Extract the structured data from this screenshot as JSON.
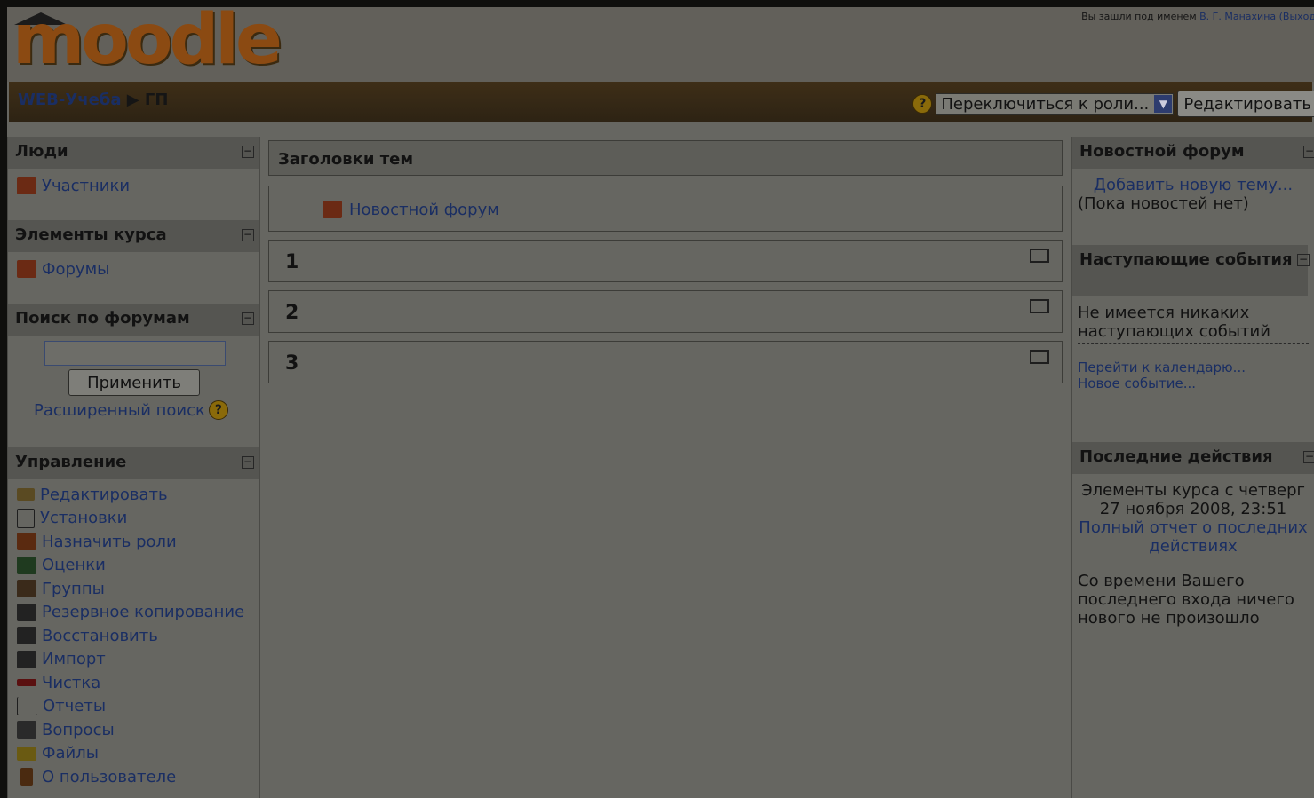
{
  "header": {
    "logo_text": "moodle",
    "login_prefix": "Вы зашли под именем ",
    "login_user": "В. Г. Манахина",
    "logout": "(Выход"
  },
  "navbar": {
    "breadcrumb_home": "WEB-Учеба",
    "breadcrumb_sep": "▶",
    "breadcrumb_current": "ГП",
    "help_glyph": "?",
    "role_select_value": "Переключиться к роли...",
    "edit_button": "Редактировать"
  },
  "left": {
    "people": {
      "title": "Люди",
      "items": [
        "Участники"
      ]
    },
    "activities": {
      "title": "Элементы курса",
      "items": [
        "Форумы"
      ]
    },
    "search": {
      "title": "Поиск по форумам",
      "button": "Применить",
      "advanced": "Расширенный поиск"
    },
    "admin": {
      "title": "Управление",
      "items": [
        {
          "label": "Редактировать",
          "icon": "pencil-icon"
        },
        {
          "label": "Установки",
          "icon": "settings-icon"
        },
        {
          "label": "Назначить роли",
          "icon": "roles-icon"
        },
        {
          "label": "Оценки",
          "icon": "grades-icon"
        },
        {
          "label": "Группы",
          "icon": "groups-icon"
        },
        {
          "label": "Резервное копирование",
          "icon": "backup-icon"
        },
        {
          "label": "Восстановить",
          "icon": "restore-icon"
        },
        {
          "label": "Импорт",
          "icon": "import-icon"
        },
        {
          "label": "Чистка",
          "icon": "reset-icon"
        },
        {
          "label": "Отчеты",
          "icon": "reports-icon"
        },
        {
          "label": "Вопросы",
          "icon": "questions-icon"
        },
        {
          "label": "Файлы",
          "icon": "folder-icon"
        },
        {
          "label": "О пользователе",
          "icon": "profile-icon"
        }
      ]
    },
    "hide_glyph": "−"
  },
  "center": {
    "topics_header": "Заголовки тем",
    "news_forum": "Новостной форум",
    "sections": [
      "1",
      "2",
      "3"
    ]
  },
  "right": {
    "news": {
      "title": "Новостной форум",
      "add": "Добавить новую тему...",
      "none": "(Пока новостей нет)"
    },
    "events": {
      "title": "Наступающие события",
      "none": "Не имеется никаких наступающих событий",
      "calendar": "Перейти к календарю...",
      "new_event": "Новое событие..."
    },
    "recent": {
      "title": "Последние действия",
      "since": "Элементы курса с четверг 27 ноября 2008, 23:51",
      "full_report": "Полный отчет о последних действиях",
      "nothing": "Со времени Вашего последнего входа ничего нового не произошло"
    }
  },
  "colors": {
    "link": "#1a2e63",
    "page_bg": "#666661",
    "navbar": "#3e2e17",
    "logo": "#8b4a12"
  }
}
